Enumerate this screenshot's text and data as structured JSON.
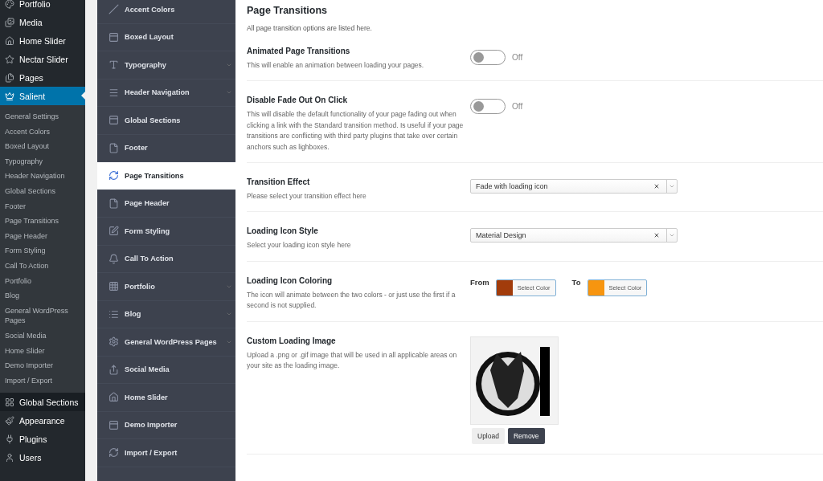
{
  "wp_menu": {
    "items": [
      {
        "label": "Portfolio",
        "selected": false
      },
      {
        "label": "Media",
        "selected": false
      },
      {
        "label": "Home Slider",
        "selected": false
      },
      {
        "label": "Nectar Slider",
        "selected": false
      },
      {
        "label": "Pages",
        "selected": false
      },
      {
        "label": "Salient",
        "selected": true,
        "children": [
          {
            "label": "General Settings",
            "selected": false
          },
          {
            "label": "Accent Colors",
            "selected": false
          },
          {
            "label": "Boxed Layout",
            "selected": false
          },
          {
            "label": "Typography",
            "selected": false
          },
          {
            "label": "Header Navigation",
            "selected": false
          },
          {
            "label": "Global Sections",
            "selected": false
          },
          {
            "label": "Footer",
            "selected": false
          },
          {
            "label": "Page Transitions",
            "selected": false
          },
          {
            "label": "Page Header",
            "selected": false
          },
          {
            "label": "Form Styling",
            "selected": false
          },
          {
            "label": "Call To Action",
            "selected": false
          },
          {
            "label": "Portfolio",
            "selected": false
          },
          {
            "label": "Blog",
            "selected": false
          },
          {
            "label": "General WordPress Pages",
            "selected": false
          },
          {
            "label": "Social Media",
            "selected": false
          },
          {
            "label": "Home Slider",
            "selected": false
          },
          {
            "label": "Demo Importer",
            "selected": false
          },
          {
            "label": "Import / Export",
            "selected": false
          }
        ]
      },
      {
        "label": "Global Sections",
        "selected": false
      },
      {
        "label": "Appearance",
        "selected": false
      },
      {
        "label": "Plugins",
        "selected": false
      },
      {
        "label": "Users",
        "selected": false
      }
    ]
  },
  "options_nav": {
    "items": [
      {
        "label": "Accent Colors",
        "selected": false,
        "expandable": false
      },
      {
        "label": "Boxed Layout",
        "selected": false,
        "expandable": false
      },
      {
        "label": "Typography",
        "selected": false,
        "expandable": true
      },
      {
        "label": "Header Navigation",
        "selected": false,
        "expandable": true
      },
      {
        "label": "Global Sections",
        "selected": false,
        "expandable": false
      },
      {
        "label": "Footer",
        "selected": false,
        "expandable": false
      },
      {
        "label": "Page Transitions",
        "selected": true,
        "expandable": false
      },
      {
        "label": "Page Header",
        "selected": false,
        "expandable": false
      },
      {
        "label": "Form Styling",
        "selected": false,
        "expandable": false
      },
      {
        "label": "Call To Action",
        "selected": false,
        "expandable": false
      },
      {
        "label": "Portfolio",
        "selected": false,
        "expandable": true
      },
      {
        "label": "Blog",
        "selected": false,
        "expandable": true
      },
      {
        "label": "General WordPress Pages",
        "selected": false,
        "expandable": true
      },
      {
        "label": "Social Media",
        "selected": false,
        "expandable": false
      },
      {
        "label": "Home Slider",
        "selected": false,
        "expandable": false
      },
      {
        "label": "Demo Importer",
        "selected": false,
        "expandable": false
      },
      {
        "label": "Import / Export",
        "selected": false,
        "expandable": false
      }
    ]
  },
  "section": {
    "title": "Page Transitions",
    "description": "All page transition options are listed here."
  },
  "settings": [
    {
      "kind": "toggle",
      "title": "Animated Page Transitions",
      "description": "This will enable an animation between loading your pages.",
      "on": false,
      "state_label": "Off"
    },
    {
      "kind": "toggle",
      "title": "Disable Fade Out On Click",
      "description": "This will disable the default functionality of your page fading out when clicking a link with the Standard transition method. Is useful if your page transitions are conflicting with third party plugins that take over certain anchors such as lighboxes.",
      "on": false,
      "state_label": "Off"
    },
    {
      "kind": "select",
      "title": "Transition Effect",
      "description": "Please select your transition effect here",
      "value": "Fade with loading icon"
    },
    {
      "kind": "select",
      "title": "Loading Icon Style",
      "description": "Select your loading icon style here",
      "value": "Material Design"
    },
    {
      "kind": "colors",
      "title": "Loading Icon Coloring",
      "description": "The icon will animate between the two colors - or just use the first if a second is not supplied.",
      "pickers": [
        {
          "label": "From",
          "color": "#a23c0b",
          "button": "Select Color"
        },
        {
          "label": "To",
          "color": "#f7950f",
          "button": "Select Color"
        }
      ]
    },
    {
      "kind": "image",
      "title": "Custom Loading Image",
      "description": "Upload a .png or .gif image that will be used in all applicable areas on your site as the loading image.",
      "buttons": [
        {
          "label": "Upload",
          "primary": false
        },
        {
          "label": "Remove",
          "primary": true
        }
      ]
    }
  ]
}
